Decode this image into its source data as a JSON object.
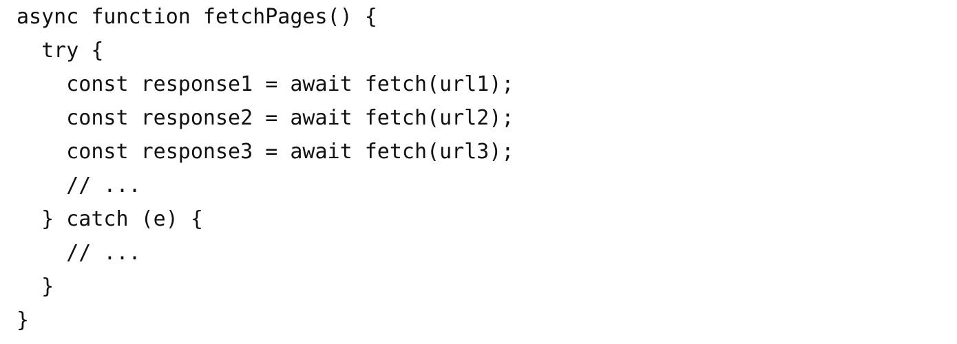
{
  "code": {
    "lines": [
      "async function fetchPages() {",
      "  try {",
      "    const response1 = await fetch(url1);",
      "    const response2 = await fetch(url2);",
      "    const response3 = await fetch(url3);",
      "    // ...",
      "  } catch (e) {",
      "    // ...",
      "  }",
      "}"
    ]
  }
}
